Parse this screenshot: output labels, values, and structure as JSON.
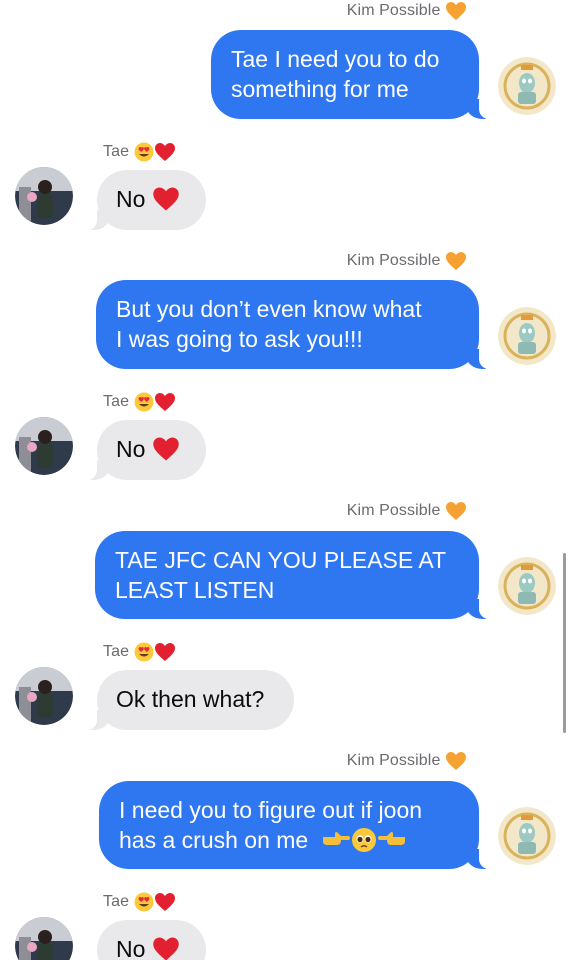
{
  "contacts": {
    "me": {
      "name": "Kim Possible",
      "badge_icon": "orange-heart-icon",
      "avatar_icon": "squidward-avatar-icon"
    },
    "them": {
      "name": "Tae",
      "badge_icons": [
        "heart-eyes-icon",
        "red-heart-icon"
      ],
      "avatar_icon": "person-photo-avatar-icon"
    }
  },
  "colors": {
    "outgoing_bubble": "#2e77f0",
    "incoming_bubble": "#e9e9eb",
    "name_text": "#6b6b70"
  },
  "messages": [
    {
      "from": "me",
      "sender": "Kim Possible",
      "lines": [
        "Tae I need you to do",
        "something for me"
      ]
    },
    {
      "from": "them",
      "sender": "Tae",
      "text": "No",
      "emoji": "red-heart"
    },
    {
      "from": "me",
      "sender": "Kim Possible",
      "lines": [
        "But you don’t even know what",
        "I was going to ask you!!!"
      ]
    },
    {
      "from": "them",
      "sender": "Tae",
      "text": "No",
      "emoji": "red-heart"
    },
    {
      "from": "me",
      "sender": "Kim Possible",
      "lines": [
        "TAE JFC CAN YOU PLEASE AT",
        "LEAST LISTEN"
      ]
    },
    {
      "from": "them",
      "sender": "Tae",
      "text": "Ok then what?"
    },
    {
      "from": "me",
      "sender": "Kim Possible",
      "lines": [
        "I need you to figure out if joon",
        "has a crush on me"
      ],
      "trailing_emojis": [
        "pointing-right-icon",
        "pleading-face-icon",
        "pointing-left-icon"
      ]
    },
    {
      "from": "them",
      "sender": "Tae",
      "text": "No",
      "emoji": "red-heart"
    }
  ]
}
